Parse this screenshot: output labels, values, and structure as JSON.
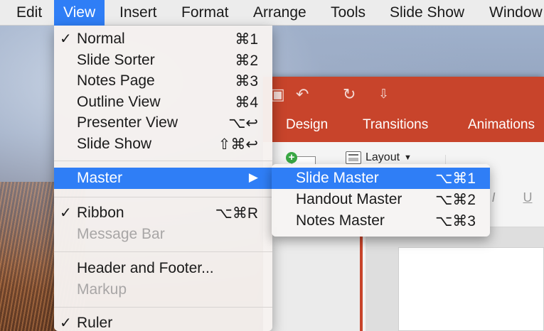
{
  "menubar": {
    "items": [
      "Edit",
      "View",
      "Insert",
      "Format",
      "Arrange",
      "Tools",
      "Slide Show",
      "Window"
    ],
    "active_index": 1
  },
  "view_menu": {
    "items": [
      {
        "check": "✓",
        "label": "Normal",
        "shortcut": "⌘1"
      },
      {
        "check": "",
        "label": "Slide Sorter",
        "shortcut": "⌘2"
      },
      {
        "check": "",
        "label": "Notes Page",
        "shortcut": "⌘3"
      },
      {
        "check": "",
        "label": "Outline View",
        "shortcut": "⌘4"
      },
      {
        "check": "",
        "label": "Presenter View",
        "shortcut": "⌥↩"
      },
      {
        "check": "",
        "label": "Slide Show",
        "shortcut": "⇧⌘↩"
      },
      {
        "check": "",
        "label": "Master",
        "shortcut": "▶"
      },
      {
        "check": "✓",
        "label": "Ribbon",
        "shortcut": "⌥⌘R"
      },
      {
        "check": "",
        "label": "Message Bar",
        "shortcut": ""
      },
      {
        "check": "",
        "label": "Header and Footer...",
        "shortcut": ""
      },
      {
        "check": "",
        "label": "Markup",
        "shortcut": ""
      },
      {
        "check": "✓",
        "label": "Ruler",
        "shortcut": ""
      }
    ]
  },
  "master_submenu": {
    "items": [
      {
        "label": "Slide Master",
        "shortcut": "⌥⌘1"
      },
      {
        "label": "Handout Master",
        "shortcut": "⌥⌘2"
      },
      {
        "label": "Notes Master",
        "shortcut": "⌥⌘3"
      }
    ]
  },
  "ppt": {
    "tabs": [
      "Design",
      "Transitions",
      "Animations"
    ],
    "layout_label": "Layout",
    "format_buttons": [
      "I",
      "U"
    ]
  },
  "colors": {
    "accent": "#2f7ef6",
    "ppt_brand": "#c8442b"
  }
}
